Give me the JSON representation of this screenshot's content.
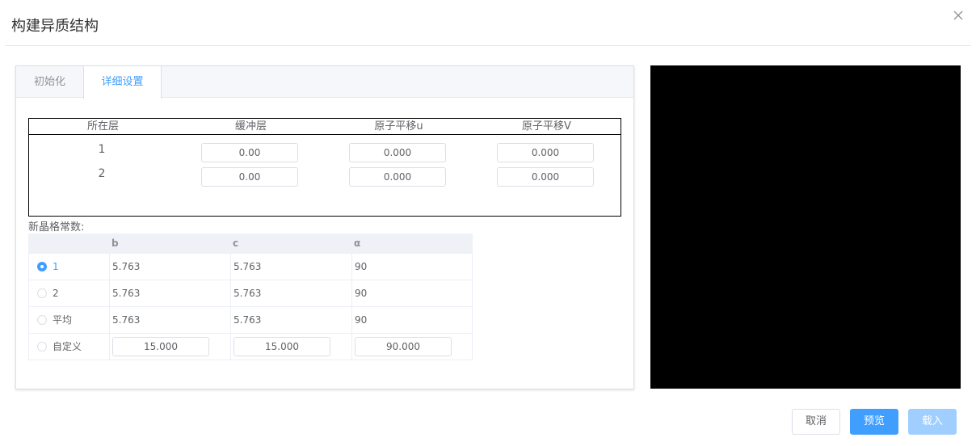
{
  "dialog": {
    "title": "构建异质结构"
  },
  "tabs": [
    {
      "label": "初始化",
      "active": false
    },
    {
      "label": "详细设置",
      "active": true
    }
  ],
  "layer_table": {
    "headers": [
      "所在层",
      "缓冲层",
      "原子平移u",
      "原子平移V"
    ],
    "rows": [
      {
        "layer": "1",
        "buffer": "0.00",
        "shift_u": "0.000",
        "shift_v": "0.000"
      },
      {
        "layer": "2",
        "buffer": "0.00",
        "shift_u": "0.000",
        "shift_v": "0.000"
      }
    ]
  },
  "lattice": {
    "label": "新晶格常数:",
    "headers": [
      "b",
      "c",
      "α"
    ],
    "rows": [
      {
        "option": "1",
        "b": "5.763",
        "c": "5.763",
        "alpha": "90",
        "selected": true
      },
      {
        "option": "2",
        "b": "5.763",
        "c": "5.763",
        "alpha": "90",
        "selected": false
      },
      {
        "option": "平均",
        "b": "5.763",
        "c": "5.763",
        "alpha": "90",
        "selected": false
      }
    ],
    "custom": {
      "option": "自定义",
      "b": "15.000",
      "c": "15.000",
      "alpha": "90.000",
      "selected": false
    }
  },
  "footer": {
    "cancel_label": "取消",
    "preview_label": "预览",
    "load_label": "载入"
  },
  "colors": {
    "primary": "#409eff",
    "disabled_primary": "#a0cfff",
    "preview_bg": "#000000"
  }
}
